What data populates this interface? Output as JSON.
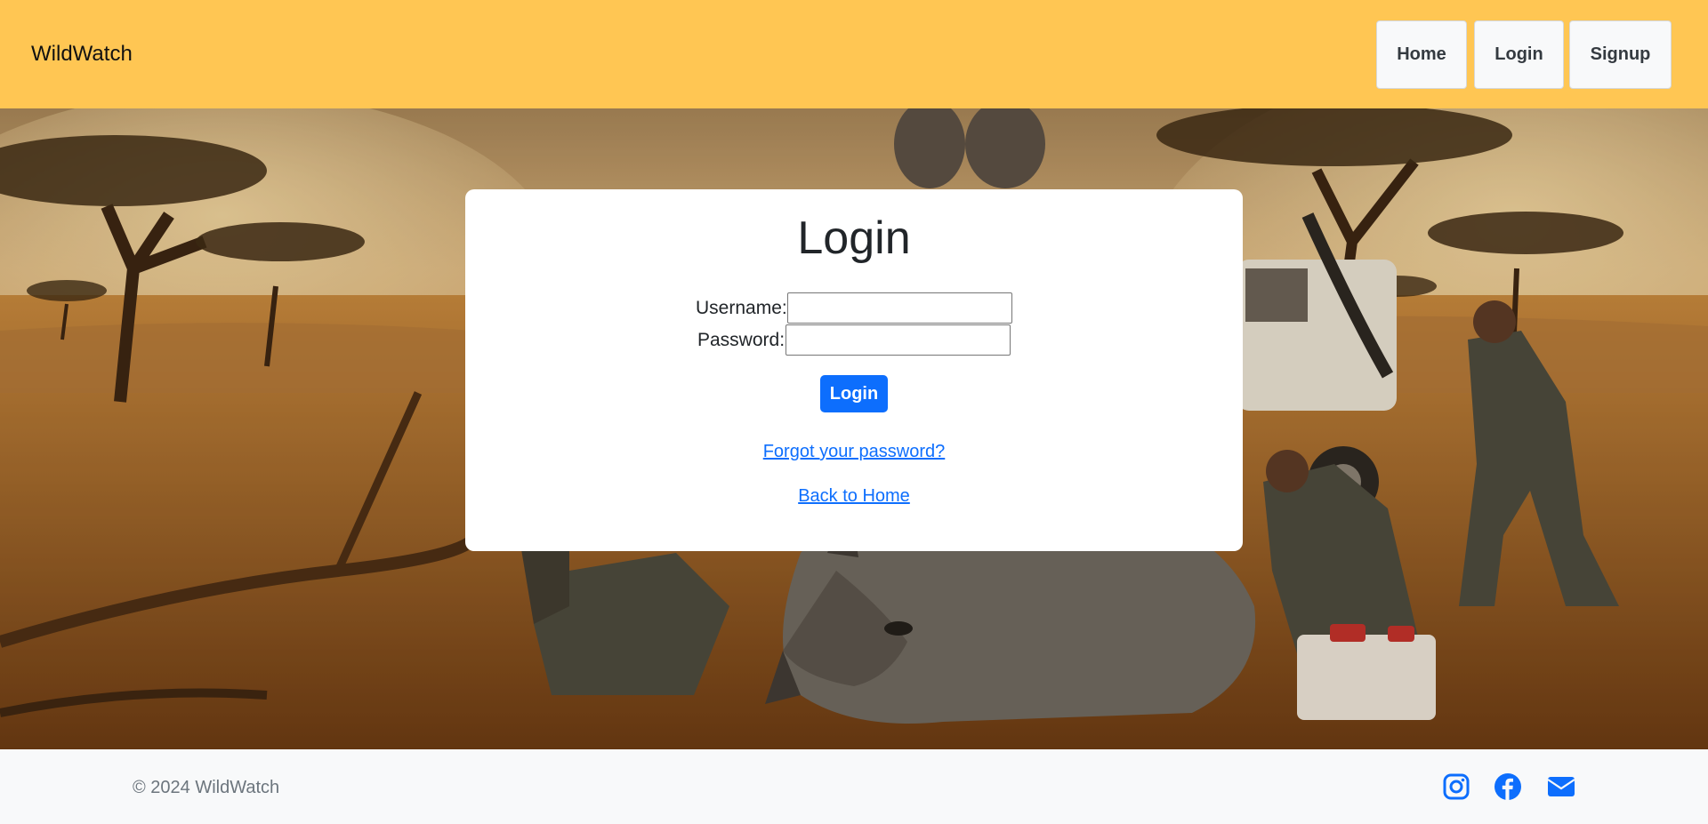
{
  "navbar": {
    "brand": "WildWatch",
    "links": [
      {
        "label": "Home"
      },
      {
        "label": "Login"
      },
      {
        "label": "Signup"
      }
    ]
  },
  "login_form": {
    "title": "Login",
    "username_label": "Username:",
    "username_value": "",
    "password_label": "Password:",
    "password_value": "",
    "submit_label": "Login",
    "forgot_link": "Forgot your password?",
    "back_link": "Back to Home"
  },
  "footer": {
    "copyright": "© 2024 WildWatch",
    "social_icons": [
      "instagram-icon",
      "facebook-icon",
      "envelope-icon"
    ]
  },
  "colors": {
    "navbar_bg": "#ffc653",
    "primary": "#0d6efd",
    "footer_bg": "#f8f9fa"
  }
}
